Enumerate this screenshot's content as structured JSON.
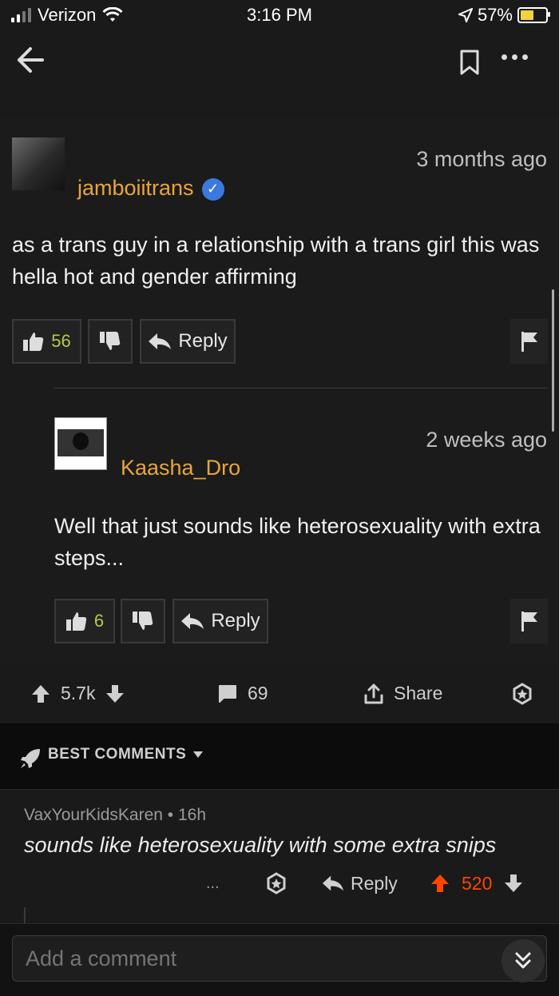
{
  "status_bar": {
    "carrier": "Verizon",
    "time": "3:16 PM",
    "battery": "57%"
  },
  "comment1": {
    "username": "jamboiitrans",
    "time_ago": "3 months ago",
    "text": "as a trans guy in a relationship with a trans girl this was hella hot and gender affirming",
    "likes": "56",
    "reply_label": "Reply"
  },
  "comment2": {
    "username": "Kaasha_Dro",
    "time_ago": "2 weeks ago",
    "text": "Well that just sounds like heterosexuality with extra steps...",
    "likes": "6",
    "reply_label": "Reply"
  },
  "post_bar": {
    "score": "5.7k",
    "comments": "69",
    "share_label": "Share"
  },
  "best_comments": {
    "label": "BEST COMMENTS"
  },
  "reddit_comment": {
    "author": "VaxYourKidsKaren",
    "age": "16h",
    "text": "sounds like heterosexuality with some extra snips",
    "reply_label": "Reply",
    "score": "520",
    "more": "..."
  },
  "input": {
    "placeholder": "Add a comment"
  },
  "colors": {
    "username": "#e9a53b",
    "upvote": "#ff4500",
    "verified": "#3d78e0",
    "like_count": "#b5c947"
  }
}
